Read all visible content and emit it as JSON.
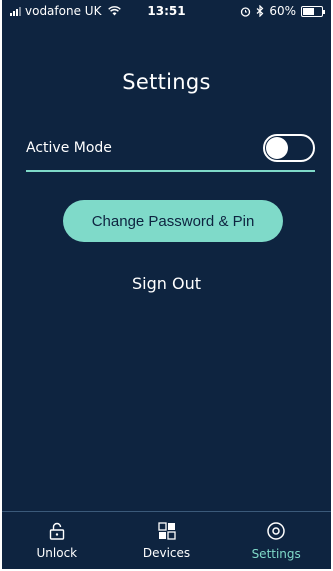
{
  "status_bar": {
    "carrier": "vodafone UK",
    "time": "13:51",
    "battery_percent": "60%",
    "battery_level": 0.6
  },
  "header": {
    "title": "Settings"
  },
  "settings": {
    "active_mode_label": "Active Mode",
    "active_mode_on": false
  },
  "actions": {
    "change_password_label": "Change Password & Pin",
    "sign_out_label": "Sign Out"
  },
  "tab_bar": {
    "tabs": [
      {
        "label": "Unlock",
        "icon": "unlock-icon",
        "active": false
      },
      {
        "label": "Devices",
        "icon": "devices-icon",
        "active": false
      },
      {
        "label": "Settings",
        "icon": "settings-icon",
        "active": true
      }
    ]
  },
  "colors": {
    "background": "#0e2440",
    "accent": "#7fdac9",
    "text": "#ffffff"
  }
}
